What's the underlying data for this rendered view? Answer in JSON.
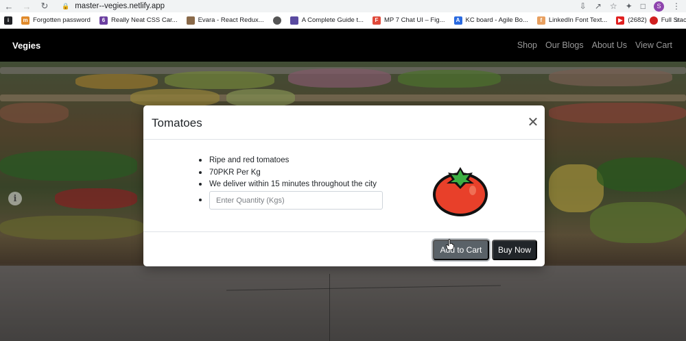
{
  "browser": {
    "url": "master--vegies.netlify.app",
    "profile_initial": "S",
    "bookmarks": [
      {
        "label": "Forgotten password",
        "icon": "facebook-icon",
        "color": "#e08a2b"
      },
      {
        "label": "Really Neat CSS Car...",
        "icon": "codepen-icon",
        "color": "#6b3fa0"
      },
      {
        "label": "Evara - React Redux...",
        "icon": "image-icon",
        "color": "#8a6a4a"
      },
      {
        "label": "",
        "icon": "globe-icon",
        "color": "#555555"
      },
      {
        "label": "A Complete Guide t...",
        "icon": "page-icon",
        "color": "#5a4aa0"
      },
      {
        "label": "MP 7 Chat UI – Fig...",
        "icon": "figma-icon",
        "color": "#e04a3b"
      },
      {
        "label": "KC board - Agile Bo...",
        "icon": "atlassian-icon",
        "color": "#2a6ae0"
      },
      {
        "label": "LinkedIn Font Text...",
        "icon": "fonts-icon",
        "color": "#e8a060"
      },
      {
        "label": "(2682)",
        "icon": "youtube-icon",
        "color": "#e02020"
      },
      {
        "label": "Full Stack...",
        "icon": "record-icon",
        "color": "#d02020"
      }
    ]
  },
  "site": {
    "brand": "Vegies",
    "nav": [
      "Shop",
      "Our Blogs",
      "About Us",
      "View Cart"
    ]
  },
  "modal": {
    "title": "Tomatoes",
    "details": [
      "Ripe and red tomatoes",
      "70PKR Per Kg",
      "We deliver within 15 minutes throughout the city"
    ],
    "quantity_placeholder": "Enter Quantity (Kgs)",
    "add_to_cart_label": "Add to Cart",
    "buy_now_label": "Buy Now",
    "product_icon": "tomato-icon"
  },
  "colors": {
    "navbar": "#000000",
    "tomato_red": "#e8402a",
    "tomato_leaf": "#3cb043",
    "button_secondary": "#5a6268",
    "button_dark": "#212529"
  }
}
